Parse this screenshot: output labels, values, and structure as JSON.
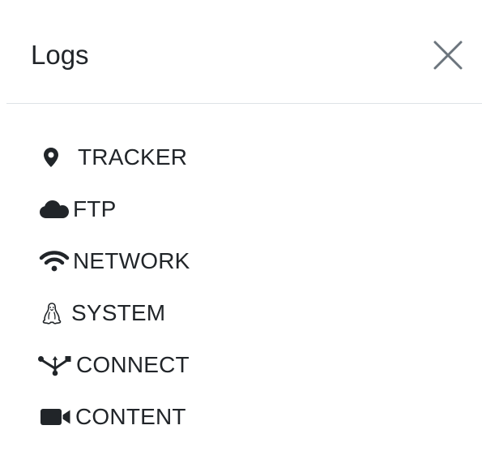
{
  "modal": {
    "title": "Logs",
    "close_icon": "close-icon"
  },
  "logs": {
    "items": [
      {
        "label": "TRACKER",
        "icon": "map-marker-icon"
      },
      {
        "label": "FTP",
        "icon": "cloud-icon"
      },
      {
        "label": "NETWORK",
        "icon": "wifi-icon"
      },
      {
        "label": "SYSTEM",
        "icon": "linux-icon"
      },
      {
        "label": "CONNECT",
        "icon": "usb-icon"
      },
      {
        "label": "CONTENT",
        "icon": "video-camera-icon"
      }
    ]
  },
  "colors": {
    "text": "#212529",
    "icon": "#212529",
    "divider": "#dee2e6",
    "close": "#6c757d"
  }
}
